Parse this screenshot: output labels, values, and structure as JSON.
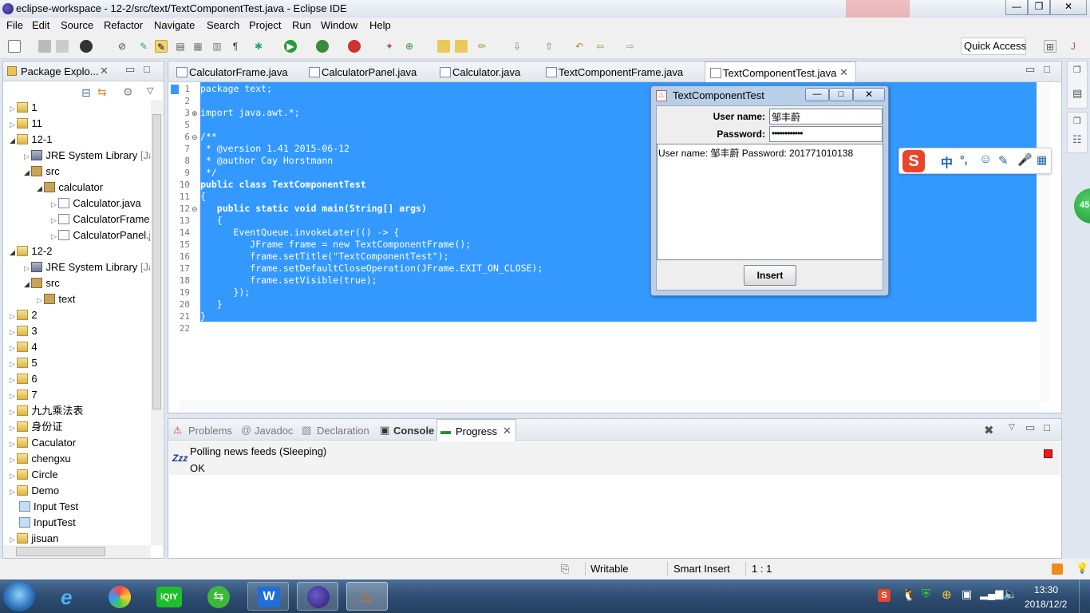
{
  "window": {
    "title": "eclipse-workspace - 12-2/src/text/TextComponentTest.java - Eclipse IDE",
    "min": "—",
    "max": "❐",
    "close": "✕"
  },
  "menu": [
    "File",
    "Edit",
    "Source",
    "Refactor",
    "Navigate",
    "Search",
    "Project",
    "Run",
    "Window",
    "Help"
  ],
  "toolbar": {
    "quick_access": "Quick Access"
  },
  "explorer": {
    "title": "Package Explo...",
    "items": [
      {
        "label": "1"
      },
      {
        "label": "11"
      },
      {
        "label": "12-1"
      },
      {
        "label": "JRE System Library",
        "suffix": "[Ja"
      },
      {
        "label": "src"
      },
      {
        "label": "calculator"
      },
      {
        "label": "Calculator.java"
      },
      {
        "label": "CalculatorFrame"
      },
      {
        "label": "CalculatorPanel.j"
      },
      {
        "label": "12-2"
      },
      {
        "label": "JRE System Library",
        "suffix": "[Ja"
      },
      {
        "label": "src"
      },
      {
        "label": "text"
      },
      {
        "label": "2"
      },
      {
        "label": "3"
      },
      {
        "label": "4"
      },
      {
        "label": "5"
      },
      {
        "label": "6"
      },
      {
        "label": "7"
      },
      {
        "label": "九九乘法表"
      },
      {
        "label": "身份证"
      },
      {
        "label": "Caculator"
      },
      {
        "label": "chengxu"
      },
      {
        "label": "Circle"
      },
      {
        "label": "Demo"
      },
      {
        "label": "Input Test"
      },
      {
        "label": "InputTest"
      },
      {
        "label": "jisuan"
      }
    ]
  },
  "editor": {
    "tabs": [
      "CalculatorFrame.java",
      "CalculatorPanel.java",
      "Calculator.java",
      "TextComponentFrame.java",
      "TextComponentTest.java"
    ],
    "active_tab": 4,
    "lines": [
      {
        "n": "1",
        "code": "package text;"
      },
      {
        "n": "2",
        "code": ""
      },
      {
        "n": "3",
        "code": "import java.awt.*;"
      },
      {
        "n": "5",
        "code": ""
      },
      {
        "n": "6",
        "code": "/**"
      },
      {
        "n": "7",
        "code": " * @version 1.41 2015-06-12"
      },
      {
        "n": "8",
        "code": " * @author Cay Horstmann"
      },
      {
        "n": "9",
        "code": " */"
      },
      {
        "n": "10",
        "code": "public class TextComponentTest"
      },
      {
        "n": "11",
        "code": "{"
      },
      {
        "n": "12",
        "code": "   public static void main(String[] args)"
      },
      {
        "n": "13",
        "code": "   {"
      },
      {
        "n": "14",
        "code": "      EventQueue.invokeLater(() -> {"
      },
      {
        "n": "15",
        "code": "         JFrame frame = new TextComponentFrame();"
      },
      {
        "n": "16",
        "code": "         frame.setTitle(\"TextComponentTest\");"
      },
      {
        "n": "17",
        "code": "         frame.setDefaultCloseOperation(JFrame.EXIT_ON_CLOSE);"
      },
      {
        "n": "18",
        "code": "         frame.setVisible(true);"
      },
      {
        "n": "19",
        "code": "      });"
      },
      {
        "n": "20",
        "code": "   }"
      },
      {
        "n": "21",
        "code": "}"
      },
      {
        "n": "22",
        "code": ""
      }
    ]
  },
  "dialog": {
    "title": "TextComponentTest",
    "username_label": "User name:",
    "username_value": "邹丰蔚",
    "password_label": "Password:",
    "password_value": "••••••••••••",
    "output": "User name: 邹丰蔚 Password: 201771010138",
    "insert_button": "Insert"
  },
  "bottom": {
    "tabs": [
      "Problems",
      "Javadoc",
      "Declaration",
      "Console",
      "Progress"
    ],
    "active_tab": 4,
    "progress_title": "Polling news feeds (Sleeping)",
    "progress_status": "OK",
    "sleep_icon": "Zzz"
  },
  "ime": {
    "lang": "中",
    "punct": "°,"
  },
  "statusbar": {
    "writable": "Writable",
    "insert_mode": "Smart Insert",
    "position": "1 : 1"
  },
  "taskbar": {
    "time": "13:30",
    "date": "2018/12/2",
    "badge": "45"
  },
  "colors": {
    "selection": "#3399ff",
    "accent": "#2e4d72"
  }
}
